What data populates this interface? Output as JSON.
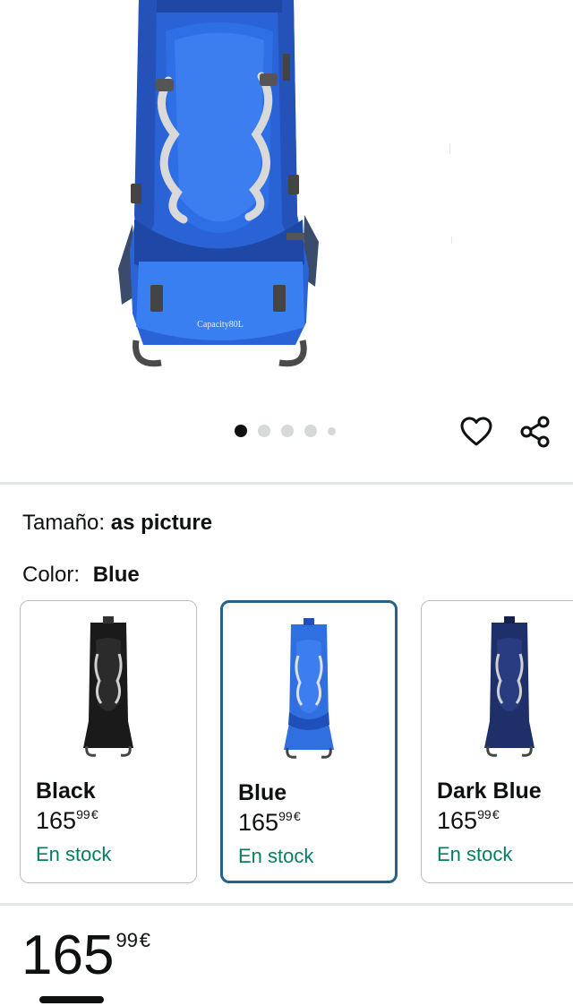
{
  "hero": {
    "image_alt": "Mochila azul de senderismo",
    "bag_print": "Capacity80L",
    "carousel": {
      "count": 5,
      "active_index": 0
    },
    "actions": {
      "favorite_icon": "heart-icon",
      "share_icon": "share-icon"
    }
  },
  "variations": {
    "size": {
      "label": "Tamaño:",
      "value": "as picture"
    },
    "color": {
      "label": "Color:",
      "value": "Blue"
    }
  },
  "swatches": [
    {
      "name": "Black",
      "price_whole": "165",
      "price_fraction": "99",
      "currency": "€",
      "stock": "En stock",
      "selected": false,
      "bag_color": "#1a1a1a",
      "accent": "#2b2b2b"
    },
    {
      "name": "Blue",
      "price_whole": "165",
      "price_fraction": "99",
      "currency": "€",
      "stock": "En stock",
      "selected": true,
      "bag_color": "#2f6fe0",
      "accent": "#1f4fb8"
    },
    {
      "name": "Dark Blue",
      "price_whole": "165",
      "price_fraction": "99",
      "currency": "€",
      "stock": "En stock",
      "selected": false,
      "bag_color": "#1f2f6a",
      "accent": "#16224e"
    }
  ],
  "price": {
    "whole": "165",
    "fraction": "99",
    "currency": "€"
  },
  "colors": {
    "stock_green": "#067d62",
    "selected_border": "#24628c"
  }
}
